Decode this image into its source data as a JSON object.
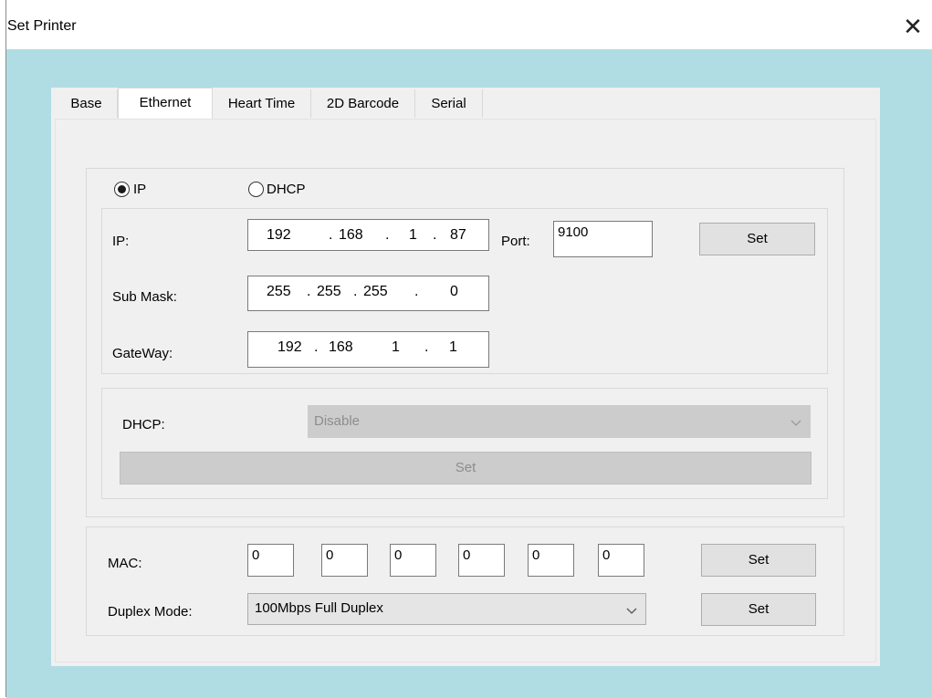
{
  "window": {
    "title": "Set Printer",
    "close_glyph": "✕"
  },
  "tabs": [
    {
      "label": "Base",
      "active": false
    },
    {
      "label": "Ethernet",
      "active": true
    },
    {
      "label": "Heart Time",
      "active": false
    },
    {
      "label": "2D Barcode",
      "active": false
    },
    {
      "label": "Serial",
      "active": false
    }
  ],
  "mode": {
    "ip_label": "IP",
    "dhcp_label": "DHCP",
    "selected": "IP"
  },
  "ip_section": {
    "ip_label": "IP:",
    "ip": [
      "192",
      "168",
      "1",
      "87"
    ],
    "port_label": "Port:",
    "port": "9100",
    "set_label": "Set",
    "submask_label": "Sub Mask:",
    "submask": [
      "255",
      "255",
      "255",
      "0"
    ],
    "gateway_label": "GateWay:",
    "gateway": [
      "192",
      "168",
      "1",
      "1"
    ],
    "dot": "."
  },
  "dhcp_section": {
    "label": "DHCP:",
    "value": "Disable",
    "set_label": "Set"
  },
  "mac_section": {
    "mac_label": "MAC:",
    "mac": [
      "0",
      "0",
      "0",
      "0",
      "0",
      "0"
    ],
    "mac_set_label": "Set",
    "duplex_label": "Duplex Mode:",
    "duplex_value": "100Mbps Full Duplex",
    "duplex_set_label": "Set"
  },
  "icons": {
    "close": "close-icon",
    "dropdown": "chevron-down-icon"
  }
}
